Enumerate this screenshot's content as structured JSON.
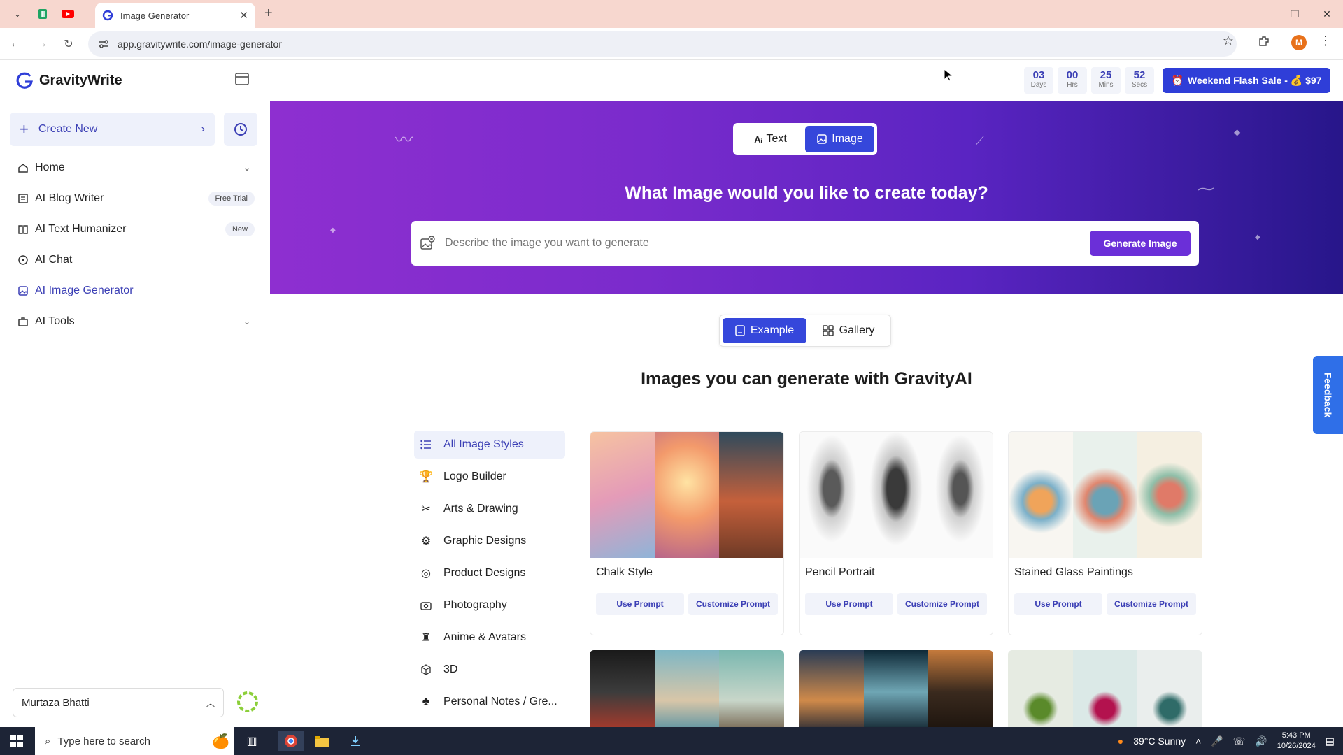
{
  "browser": {
    "tab_title": "Image Generator",
    "url": "app.gravitywrite.com/image-generator",
    "profile_initial": "M"
  },
  "sidebar": {
    "brand": "GravityWrite",
    "create_new": "Create New",
    "items": [
      {
        "label": "Home",
        "icon": "home-icon",
        "badge": ""
      },
      {
        "label": "AI Blog Writer",
        "icon": "blog-icon",
        "badge": "Free Trial"
      },
      {
        "label": "AI Text Humanizer",
        "icon": "book-icon",
        "badge": "New"
      },
      {
        "label": "AI Chat",
        "icon": "chat-icon",
        "badge": ""
      },
      {
        "label": "AI Image Generator",
        "icon": "image-icon",
        "badge": ""
      },
      {
        "label": "AI Tools",
        "icon": "tools-icon",
        "badge": ""
      }
    ],
    "user": "Murtaza Bhatti"
  },
  "timer": {
    "days": "03",
    "days_label": "Days",
    "hrs": "00",
    "hrs_label": "Hrs",
    "mins": "25",
    "mins_label": "Mins",
    "secs": "52",
    "secs_label": "Secs"
  },
  "sale_button": "Weekend Flash Sale - 💰 $97",
  "hero": {
    "tab_text": "Text",
    "tab_image": "Image",
    "title": "What Image would you like to create today?",
    "placeholder": "Describe the image you want to generate",
    "generate": "Generate Image"
  },
  "toggle": {
    "example": "Example",
    "gallery": "Gallery"
  },
  "section_title": "Images you can generate with GravityAI",
  "categories": [
    "All Image Styles",
    "Logo Builder",
    "Arts & Drawing",
    "Graphic Designs",
    "Product Designs",
    "Photography",
    "Anime & Avatars",
    "3D",
    "Personal Notes / Gre..."
  ],
  "cards": [
    {
      "title": "Chalk Style",
      "use": "Use Prompt",
      "customize": "Customize Prompt"
    },
    {
      "title": "Pencil Portrait",
      "use": "Use Prompt",
      "customize": "Customize Prompt"
    },
    {
      "title": "Stained Glass Paintings",
      "use": "Use Prompt",
      "customize": "Customize Prompt"
    }
  ],
  "feedback": "Feedback",
  "taskbar": {
    "search": "Type here to search",
    "weather": "39°C  Sunny",
    "time": "5:43 PM",
    "date": "10/26/2024"
  },
  "colors": {
    "primary": "#3547db",
    "hero_start": "#8e2fd0",
    "hero_end": "#27168a",
    "generate": "#6b2fd8"
  }
}
